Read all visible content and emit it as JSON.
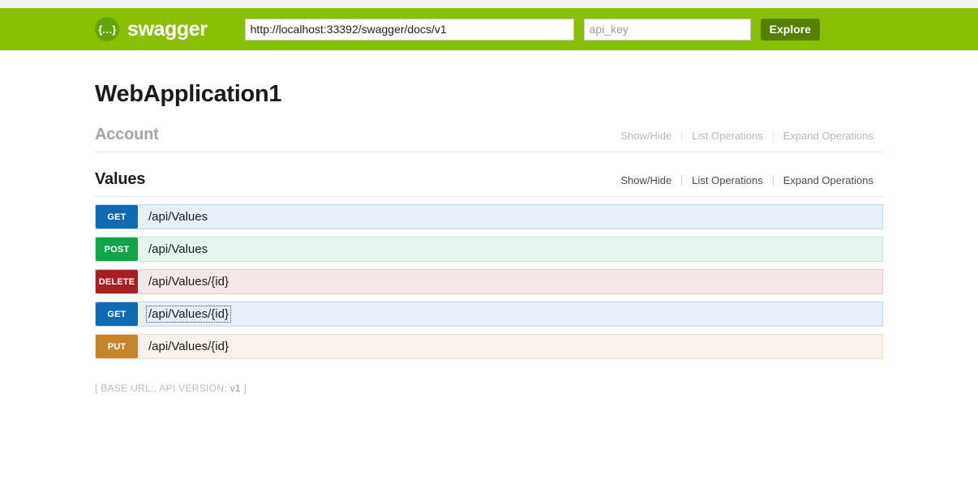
{
  "header": {
    "logo_icon": "swagger-braces-icon",
    "logo_glyph": "{…}",
    "logo_text": "swagger",
    "base_url_value": "http://localhost:33392/swagger/docs/v1",
    "base_url_placeholder": "http://example.com/api",
    "api_key_value": "",
    "api_key_placeholder": "api_key",
    "explore_label": "Explore",
    "bar_color": "#89bf04",
    "explore_color": "#547f00"
  },
  "page": {
    "title": "WebApplication1"
  },
  "resources": [
    {
      "name": "Account",
      "state": "muted",
      "options": {
        "show_hide": "Show/Hide",
        "list_operations": "List Operations",
        "expand_operations": "Expand Operations"
      },
      "operations": []
    },
    {
      "name": "Values",
      "state": "active",
      "options": {
        "show_hide": "Show/Hide",
        "list_operations": "List Operations",
        "expand_operations": "Expand Operations"
      },
      "operations": [
        {
          "method": "GET",
          "path": "/api/Values",
          "color": "#0f6ab4",
          "focused": false
        },
        {
          "method": "POST",
          "path": "/api/Values",
          "color": "#10a54a",
          "focused": false
        },
        {
          "method": "DELETE",
          "path": "/api/Values/{id}",
          "color": "#a41e22",
          "focused": false
        },
        {
          "method": "GET",
          "path": "/api/Values/{id}",
          "color": "#0f6ab4",
          "focused": true
        },
        {
          "method": "PUT",
          "path": "/api/Values/{id}",
          "color": "#c5862b",
          "focused": false
        }
      ]
    }
  ],
  "footer": {
    "open_bracket": "[",
    "base_url_label": "BASE URL:",
    "base_url_value": "",
    "separator": ",",
    "api_version_label": "API VERSION:",
    "api_version_value": "v1",
    "close_bracket": "]"
  }
}
